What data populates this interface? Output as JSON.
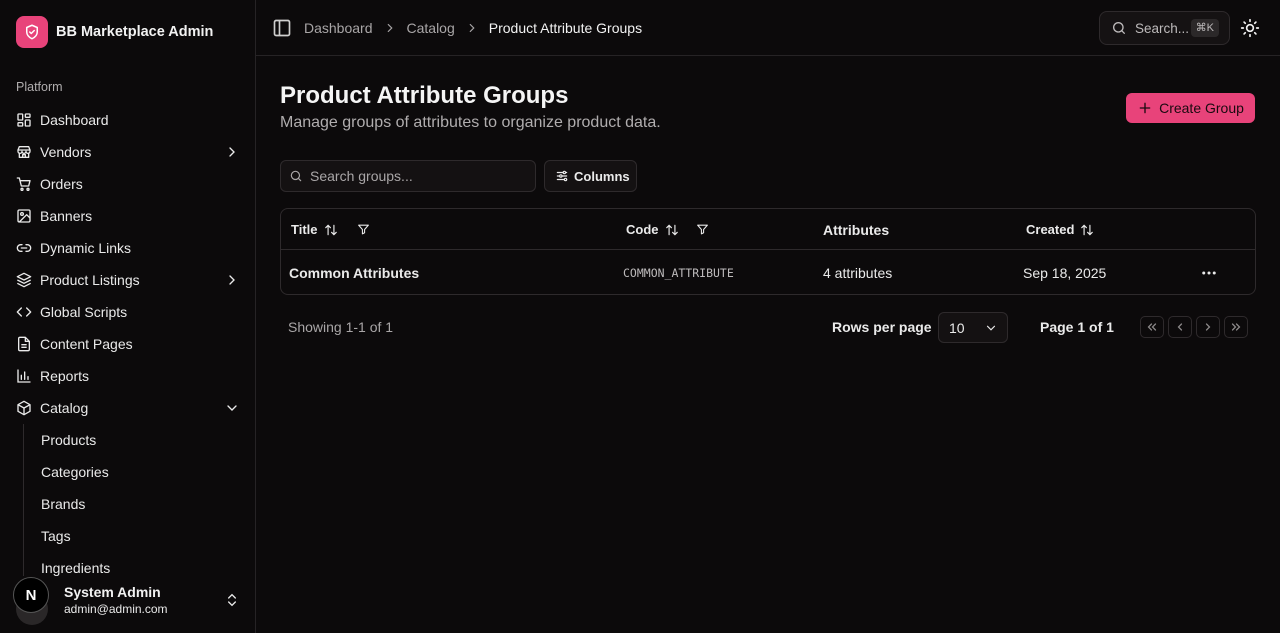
{
  "app": {
    "title": "BB Marketplace Admin",
    "accent_color": "#e8437a"
  },
  "sidebar": {
    "section_label": "Platform",
    "items": [
      {
        "label": "Dashboard",
        "icon": "dashboard-icon"
      },
      {
        "label": "Vendors",
        "icon": "store-icon",
        "has_chevron": true
      },
      {
        "label": "Orders",
        "icon": "cart-icon"
      },
      {
        "label": "Banners",
        "icon": "image-icon"
      },
      {
        "label": "Dynamic Links",
        "icon": "link-icon"
      },
      {
        "label": "Product Listings",
        "icon": "layers-icon",
        "has_chevron": true
      },
      {
        "label": "Global Scripts",
        "icon": "code-icon"
      },
      {
        "label": "Content Pages",
        "icon": "file-icon"
      },
      {
        "label": "Reports",
        "icon": "bar-chart-icon"
      },
      {
        "label": "Catalog",
        "icon": "box-icon",
        "expanded": true
      }
    ],
    "catalog_subitems": [
      "Products",
      "Categories",
      "Brands",
      "Tags",
      "Ingredients"
    ],
    "user": {
      "name": "System Admin",
      "email": "admin@admin.com",
      "badge": "N"
    }
  },
  "header": {
    "breadcrumbs": [
      "Dashboard",
      "Catalog",
      "Product Attribute Groups"
    ],
    "search_label": "Search...",
    "search_shortcut": "⌘K"
  },
  "main": {
    "title": "Product Attribute Groups",
    "subtitle": "Manage groups of attributes to organize product data.",
    "create_button": "Create Group",
    "search_placeholder": "Search groups...",
    "columns_button": "Columns"
  },
  "table": {
    "columns": [
      "Title",
      "Code",
      "Attributes",
      "Created"
    ],
    "rows": [
      {
        "title": "Common Attributes",
        "code": "COMMON_ATTRIBUTE",
        "attributes": "4 attributes",
        "created": "Sep 18, 2025"
      }
    ]
  },
  "pagination": {
    "showing": "Showing 1-1 of 1",
    "rows_per_page_label": "Rows per page",
    "rows_per_page_value": "10",
    "page_info": "Page 1 of 1"
  }
}
